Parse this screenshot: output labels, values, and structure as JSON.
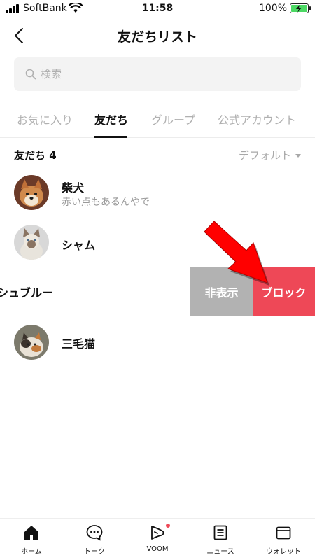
{
  "status_bar": {
    "carrier": "SoftBank",
    "time": "11:58",
    "battery": "100%"
  },
  "header": {
    "title": "友だちリスト"
  },
  "search": {
    "placeholder": "検索"
  },
  "tabs": [
    {
      "label": "お気に入り",
      "active": false
    },
    {
      "label": "友だち",
      "active": true
    },
    {
      "label": "グループ",
      "active": false
    },
    {
      "label": "公式アカウント",
      "active": false
    }
  ],
  "friends_section": {
    "heading": "友だち 4",
    "sort": "デフォルト"
  },
  "friends": [
    {
      "name": "柴犬",
      "status": "赤い点もあるんやで"
    },
    {
      "name": "シャム",
      "status": ""
    },
    {
      "name": "シュブルー",
      "status": ""
    },
    {
      "name": "三毛猫",
      "status": ""
    }
  ],
  "swipe_actions": {
    "hide": "非表示",
    "block": "ブロック"
  },
  "bottom_nav": [
    {
      "label": "ホーム",
      "icon": "home-icon"
    },
    {
      "label": "トーク",
      "icon": "chat-icon"
    },
    {
      "label": "VOOM",
      "icon": "voom-icon"
    },
    {
      "label": "ニュース",
      "icon": "news-icon"
    },
    {
      "label": "ウォレット",
      "icon": "wallet-icon"
    }
  ],
  "colors": {
    "block_red": "#ee4857",
    "hide_gray": "#b2b2b2",
    "arrow_red": "#ff0000",
    "battery_green": "#4cd964"
  }
}
